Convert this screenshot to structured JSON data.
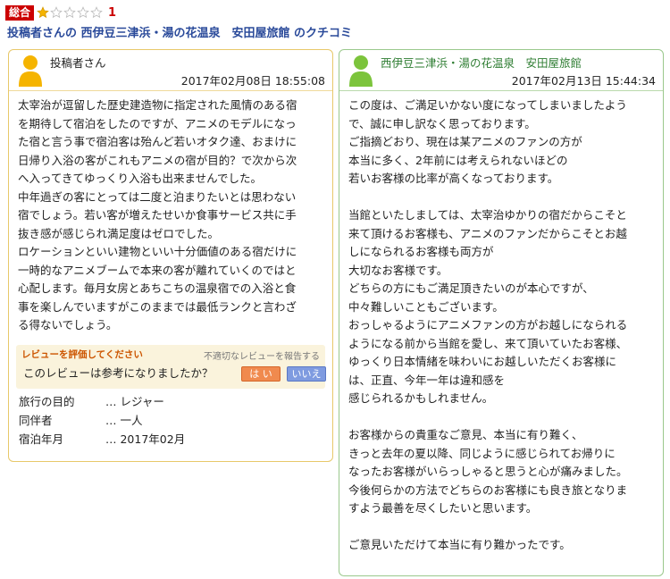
{
  "header": {
    "badge": "総合",
    "rating": 1,
    "rating_max": 5,
    "rating_label": "1",
    "title": "投稿者さんの 西伊豆三津浜・湯の花温泉　安田屋旅館 のクチコミ"
  },
  "review": {
    "author": "投稿者さん",
    "datetime": "2017年02月08日 18:55:08",
    "lines": [
      "太宰治が逗留した歴史建造物に指定された風情のある宿",
      "を期待して宿泊をしたのですが、アニメのモデルになっ",
      "た宿と言う事で宿泊客は殆んど若いオタク達、おまけに",
      "日帰り入浴の客がこれもアニメの宿が目的？で次から次",
      "へ入ってきてゆっくり入浴も出来ませんでした。",
      "中年過ぎの客にとっては二度と泊まりたいとは思わない",
      "宿でしょう。若い客が増えたせいか食事サービス共に手",
      "抜き感が感じられ満足度はゼロでした。",
      "ロケーションといい建物といい十分価値のある宿だけに",
      "一時的なアニメブームで本来の客が離れていくのではと",
      "心配します。毎月女房とあちこちの温泉宿での入浴と食",
      "事を楽しんでいますがこのままでは最低ランクと言わざ",
      "る得ないでしょう。"
    ],
    "feedback": {
      "label": "レビューを評価してください",
      "report": "不適切なレビューを報告する",
      "question": "このレビューは参考になりましたか？",
      "yes": "は い",
      "no": "いいえ"
    },
    "meta": [
      {
        "key": "旅行の目的",
        "value": "… レジャー"
      },
      {
        "key": "同伴者",
        "value": "… 一人"
      },
      {
        "key": "宿泊年月",
        "value": "… 2017年02月"
      }
    ],
    "colors": {
      "border": "#e8c86a",
      "avatar": "#f5b400"
    }
  },
  "reply": {
    "author": "西伊豆三津浜・湯の花温泉　安田屋旅館",
    "datetime": "2017年02月13日 15:44:34",
    "lines": [
      "この度は、ご満足いかない度になってしまいましたよう",
      "で、誠に申し訳なく思っております。",
      "ご指摘どおり、現在は某アニメのファンの方が",
      "本当に多く、2年前には考えられないほどの",
      "若いお客様の比率が高くなっております。",
      "",
      "当館といたしましては、太宰治ゆかりの宿だからこそと",
      "来て頂けるお客様も、アニメのファンだからこそとお越",
      "しになられるお客様も両方が",
      "大切なお客様です。",
      "どちらの方にもご満足頂きたいのが本心ですが、",
      "中々難しいこともございます。",
      "おっしゃるようにアニメファンの方がお越しになられる",
      "ようになる前から当館を愛し、来て頂いていたお客様、",
      "ゆっくり日本情緒を味わいにお越しいただくお客様に",
      "は、正直、今年一年は違和感を",
      "感じられるかもしれません。",
      "",
      "お客様からの貴重なご意見、本当に有り難く、",
      "きっと去年の夏以降、同じように感じられてお帰りに",
      "なったお客様がいらっしゃると思うと心が痛みました。",
      "今後何らかの方法でどちらのお客様にも良き旅となりま",
      "すよう最善を尽くしたいと思います。",
      "",
      "ご意見いただけて本当に有り難かったです。"
    ],
    "colors": {
      "border": "#9ac88c",
      "avatar": "#7cc43c",
      "author": "#2e7d32"
    }
  },
  "icons": {
    "star_filled": "star-filled-icon",
    "star_empty": "star-empty-icon",
    "avatar": "user-avatar-icon"
  }
}
